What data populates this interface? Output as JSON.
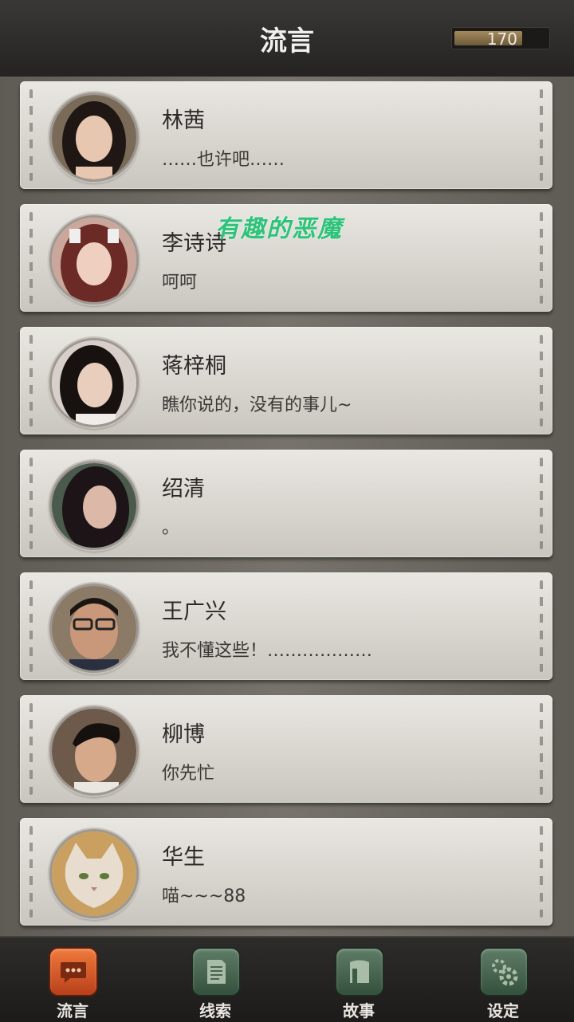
{
  "header": {
    "title": "流言",
    "currency": "170"
  },
  "watermark": "有趣的恶魔",
  "contacts": [
    {
      "name": "林茜",
      "message": "……也许吧……",
      "avatar": "young-woman-portrait"
    },
    {
      "name": "李诗诗",
      "message": "呵呵",
      "avatar": "maid-girl-portrait"
    },
    {
      "name": "蒋梓桐",
      "message": "瞧你说的，没有的事儿~",
      "avatar": "woman-portrait"
    },
    {
      "name": "绍清",
      "message": "。",
      "avatar": "woman-portrait"
    },
    {
      "name": "王广兴",
      "message": "我不懂这些！………………",
      "avatar": "man-glasses-portrait"
    },
    {
      "name": "柳博",
      "message": "你先忙",
      "avatar": "man-portrait"
    },
    {
      "name": "华生",
      "message": "喵~~~88",
      "avatar": "cat-portrait"
    }
  ],
  "tabs": [
    {
      "label": "流言",
      "icon": "chat-bubble-icon",
      "active": true
    },
    {
      "label": "线索",
      "icon": "notes-icon",
      "active": false
    },
    {
      "label": "故事",
      "icon": "book-icon",
      "active": false
    },
    {
      "label": "设定",
      "icon": "gear-icon",
      "active": false
    }
  ]
}
